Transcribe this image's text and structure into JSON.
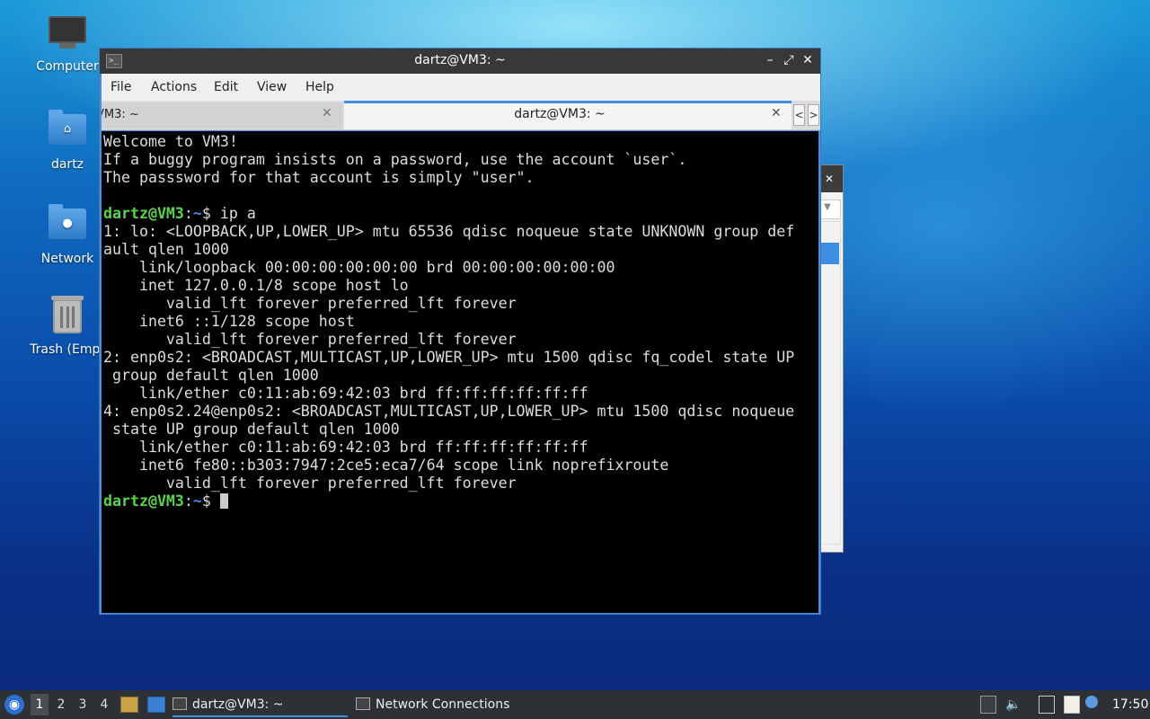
{
  "desktop": {
    "icons": [
      {
        "label": "Computer"
      },
      {
        "label": "dartz"
      },
      {
        "label": "Network"
      },
      {
        "label": "Trash (Empt"
      }
    ]
  },
  "terminal": {
    "title": "dartz@VM3: ~",
    "menu": [
      "File",
      "Actions",
      "Edit",
      "View",
      "Help"
    ],
    "tabs": [
      {
        "label": "VM3: ~",
        "close": "✕"
      },
      {
        "label": "dartz@VM3: ~",
        "close": "✕"
      }
    ],
    "tab_nav": {
      "left": "<",
      "right": ">"
    },
    "window_buttons": {
      "minimize": "–",
      "maximize": "⤢",
      "close": "✕"
    },
    "lines": [
      {
        "text": "Welcome to VM3!"
      },
      {
        "text": "If a buggy program insists on a password, use the account `user`."
      },
      {
        "text": "The passsword for that account is simply \"user\"."
      },
      {
        "text": ""
      },
      {
        "user": "dartz@VM3",
        "sep": ":",
        "path": "~",
        "text": "$ ip a"
      },
      {
        "text": "1: lo: <LOOPBACK,UP,LOWER_UP> mtu 65536 qdisc noqueue state UNKNOWN group def"
      },
      {
        "text": "ault qlen 1000"
      },
      {
        "text": "    link/loopback 00:00:00:00:00:00 brd 00:00:00:00:00:00"
      },
      {
        "text": "    inet 127.0.0.1/8 scope host lo"
      },
      {
        "text": "       valid_lft forever preferred_lft forever"
      },
      {
        "text": "    inet6 ::1/128 scope host"
      },
      {
        "text": "       valid_lft forever preferred_lft forever"
      },
      {
        "text": "2: enp0s2: <BROADCAST,MULTICAST,UP,LOWER_UP> mtu 1500 qdisc fq_codel state UP"
      },
      {
        "text": " group default qlen 1000"
      },
      {
        "text": "    link/ether c0:11:ab:69:42:03 brd ff:ff:ff:ff:ff:ff"
      },
      {
        "text": "4: enp0s2.24@enp0s2: <BROADCAST,MULTICAST,UP,LOWER_UP> mtu 1500 qdisc noqueue"
      },
      {
        "text": " state UP group default qlen 1000"
      },
      {
        "text": "    link/ether c0:11:ab:69:42:03 brd ff:ff:ff:ff:ff:ff"
      },
      {
        "text": "    inet6 fe80::b303:7947:2ce5:eca7/64 scope link noprefixroute"
      },
      {
        "text": "       valid_lft forever preferred_lft forever"
      },
      {
        "user": "dartz@VM3",
        "sep": ":",
        "path": "~",
        "text": "$ "
      }
    ]
  },
  "taskbar": {
    "workspaces": [
      "1",
      "2",
      "3",
      "4"
    ],
    "tasks": [
      {
        "label": "dartz@VM3: ~"
      },
      {
        "label": "Network Connections"
      }
    ],
    "clock": "17:50"
  },
  "colors": {
    "prompt_user": "#5ad44a",
    "prompt_path": "#4a86e8",
    "accent": "#3d8ee0"
  }
}
